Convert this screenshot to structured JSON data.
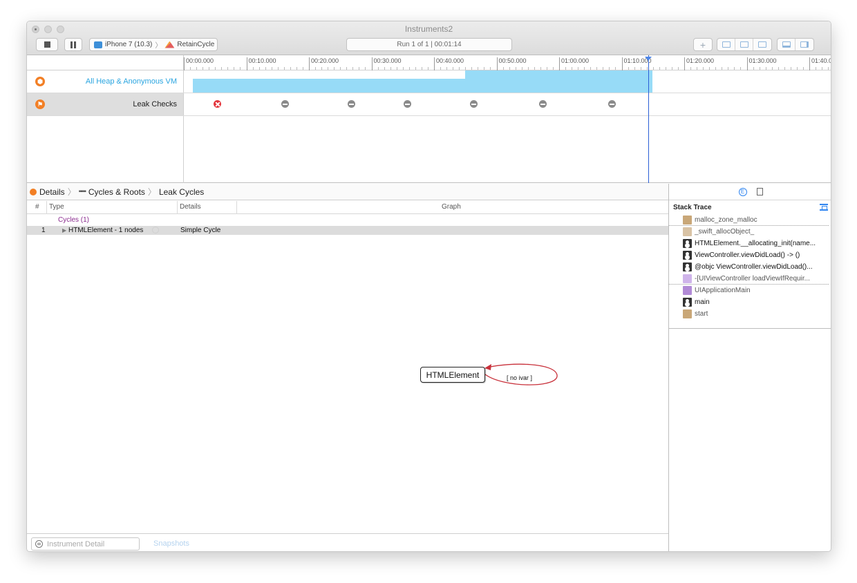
{
  "window": {
    "title": "Instruments2"
  },
  "toolbar": {
    "device": "iPhone 7 (10.3)",
    "target": "RetainCycle",
    "run_status": "Run 1 of 1  |  00:01:14",
    "add_label": "+"
  },
  "ruler": {
    "ticks": [
      "00:00.000",
      "00:10.000",
      "00:20.000",
      "00:30.000",
      "00:40.000",
      "00:50.000",
      "01:00.000",
      "01:10.000",
      "01:20.000",
      "01:30.000",
      "01:40.0"
    ]
  },
  "tracks": [
    {
      "name": "All Heap & Anonymous VM",
      "color": "#2aa5e0"
    },
    {
      "name": "Leak Checks",
      "color": "#222222"
    }
  ],
  "breadcrumb": {
    "items": [
      "Details",
      "Cycles & Roots",
      "Leak Cycles"
    ]
  },
  "table": {
    "headers": {
      "num": "#",
      "type": "Type",
      "details": "Details",
      "graph": "Graph"
    },
    "group_label": "Cycles (1)",
    "rows": [
      {
        "num": "1",
        "type": "HTMLElement - 1 nodes",
        "details": "Simple Cycle"
      }
    ]
  },
  "graph": {
    "node": "HTMLElement",
    "edge": "[ no ivar ]"
  },
  "inspector": {
    "title": "Stack Trace",
    "frames": [
      {
        "name": "malloc_zone_malloc",
        "icon": "library-tan-icon"
      },
      {
        "name": "_swift_allocObject_",
        "icon": "library-tan-light-icon"
      },
      {
        "name": "HTMLElement.__allocating_init(name...",
        "icon": "user-code-icon"
      },
      {
        "name": "ViewController.viewDidLoad() -> ()",
        "icon": "user-code-icon"
      },
      {
        "name": "@objc ViewController.viewDidLoad()...",
        "icon": "user-code-icon"
      },
      {
        "name": "-[UIViewController loadViewIfRequir...",
        "icon": "framework-purple-light-icon"
      },
      {
        "name": "UIApplicationMain",
        "icon": "framework-purple-icon"
      },
      {
        "name": "main",
        "icon": "user-code-icon"
      },
      {
        "name": "start",
        "icon": "library-tan-icon"
      }
    ]
  },
  "bottom": {
    "filter_placeholder": "Instrument Detail",
    "snapshots": "Snapshots"
  },
  "colors": {
    "heap_fill": "#97dbf7",
    "accent": "#2f85f0",
    "leak_error": "#e3343b",
    "instrument_orange": "#f27f25"
  }
}
